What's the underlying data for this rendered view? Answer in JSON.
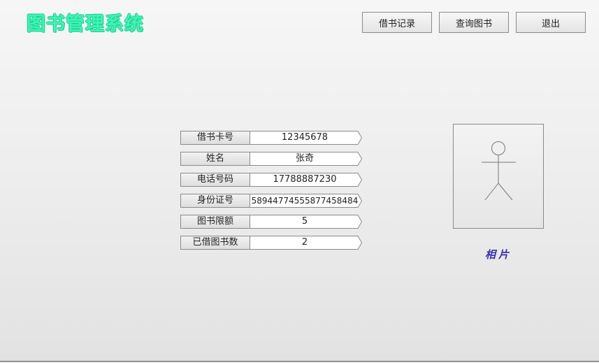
{
  "header": {
    "app_title": "图书管理系统"
  },
  "toolbar": {
    "borrow_records_label": "借书记录",
    "search_books_label": "查询图书",
    "logout_label": "退出"
  },
  "profile": {
    "fields": [
      {
        "label": "借书卡号",
        "value": "12345678"
      },
      {
        "label": "姓名",
        "value": "张奇"
      },
      {
        "label": "电话号码",
        "value": "17788887230"
      },
      {
        "label": "身份证号",
        "value": "58944774555877458484"
      },
      {
        "label": "图书限额",
        "value": "5"
      },
      {
        "label": "已借图书数",
        "value": "2"
      }
    ],
    "photo_caption": "相片",
    "photo_icon": "person-silhouette-icon"
  },
  "colors": {
    "title": "#3df5b4",
    "caption": "#3a2fa8"
  }
}
